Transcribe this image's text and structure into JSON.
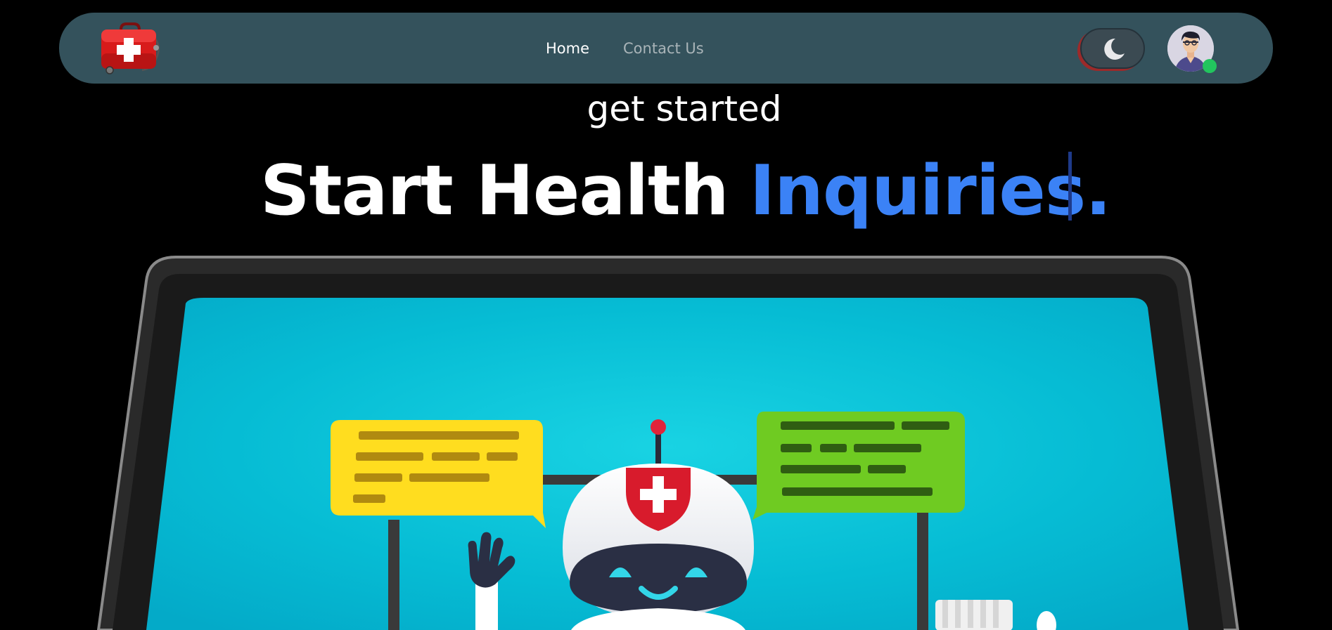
{
  "nav": {
    "home_label": "Home",
    "contact_label": "Contact Us",
    "theme_icon": "moon-icon",
    "logo_icon": "medical-kit-icon",
    "avatar_icon": "user-avatar-icon",
    "status": "online"
  },
  "hero": {
    "subtitle": "get started",
    "headline_part1": "Start Health",
    "headline_part2": "Inquiries."
  },
  "colors": {
    "background": "#000000",
    "navbar": "#34525c",
    "accent_blue": "#3b82f6",
    "status_green": "#22c55e",
    "screen_cyan": "#0fc2d6",
    "bubble_yellow": "#ffdd1f",
    "bubble_green": "#6fcb22"
  }
}
